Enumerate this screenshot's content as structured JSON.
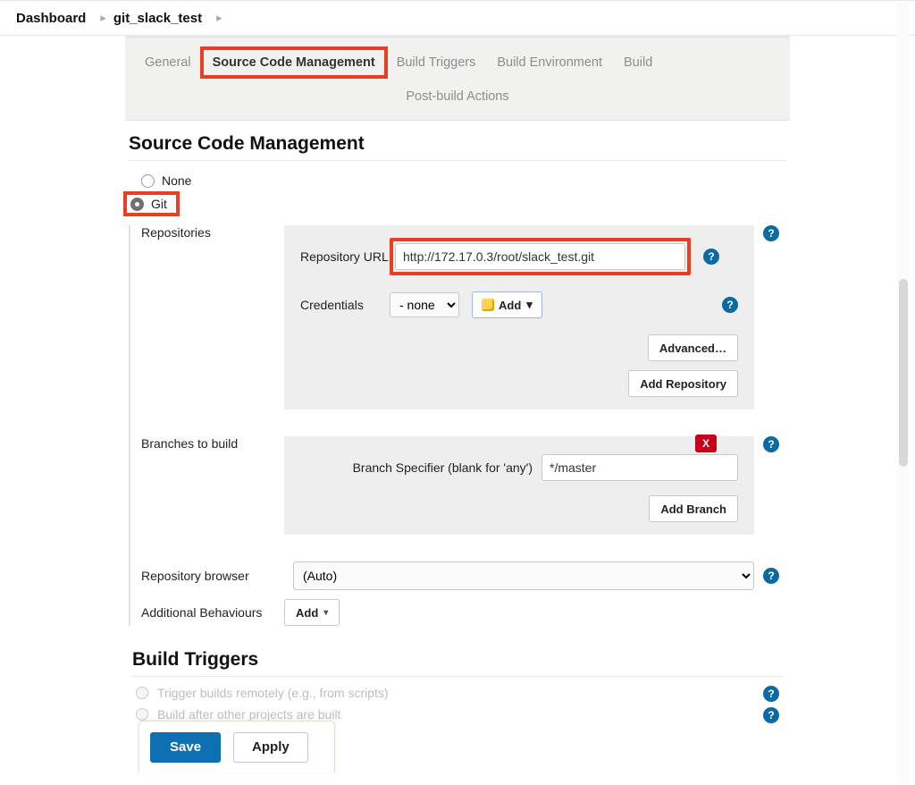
{
  "breadcrumb": {
    "root": "Dashboard",
    "project": "git_slack_test"
  },
  "tabs": {
    "general": "General",
    "scm": "Source Code Management",
    "triggers": "Build Triggers",
    "env": "Build Environment",
    "build": "Build",
    "post": "Post-build Actions"
  },
  "section": {
    "scm_heading": "Source Code Management",
    "bt_heading": "Build Triggers"
  },
  "scm": {
    "none_label": "None",
    "git_label": "Git",
    "repos_label": "Repositories",
    "repo_url_label": "Repository URL",
    "repo_url_value": "http://172.17.0.3/root/slack_test.git",
    "creds_label": "Credentials",
    "creds_value": "- none -",
    "add_cred_label": "Add",
    "advanced_label": "Advanced…",
    "add_repo_label": "Add Repository",
    "branches_label": "Branches to build",
    "branch_spec_label": "Branch Specifier (blank for 'any')",
    "branch_spec_value": "*/master",
    "add_branch_label": "Add Branch",
    "repo_browser_label": "Repository browser",
    "repo_browser_value": "(Auto)",
    "addl_behaviours_label": "Additional Behaviours",
    "addl_behaviours_btn": "Add"
  },
  "build_triggers": {
    "opt1": "Trigger builds remotely (e.g., from scripts)",
    "opt2": "Build after other projects are built"
  },
  "footer": {
    "save": "Save",
    "apply": "Apply"
  },
  "glyphs": {
    "help": "?",
    "x": "X",
    "caret": "▾",
    "sep": "▸"
  }
}
